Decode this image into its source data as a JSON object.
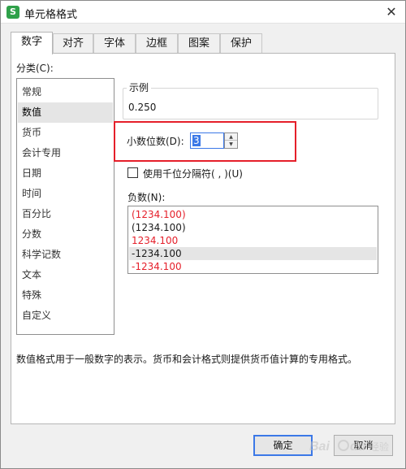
{
  "window": {
    "title": "单元格格式",
    "app_icon_letter": "S",
    "close_symbol": "✕"
  },
  "tabs": [
    {
      "label": "数字",
      "active": true
    },
    {
      "label": "对齐",
      "active": false
    },
    {
      "label": "字体",
      "active": false
    },
    {
      "label": "边框",
      "active": false
    },
    {
      "label": "图案",
      "active": false
    },
    {
      "label": "保护",
      "active": false
    }
  ],
  "category": {
    "label": "分类(C):",
    "items": [
      "常规",
      "数值",
      "货币",
      "会计专用",
      "日期",
      "时间",
      "百分比",
      "分数",
      "科学记数",
      "文本",
      "特殊",
      "自定义"
    ],
    "selected_index": 1
  },
  "sample": {
    "label": "示例",
    "value": "0.250"
  },
  "decimal": {
    "label": "小数位数(D):",
    "value": "3"
  },
  "thousands": {
    "label": "使用千位分隔符( , )(U)",
    "checked": false
  },
  "negative": {
    "label": "负数(N):",
    "items": [
      {
        "text": "(1234.100)",
        "color": "#e51f2a"
      },
      {
        "text": "(1234.100)",
        "color": "#1a1a1a"
      },
      {
        "text": "1234.100",
        "color": "#e51f2a"
      },
      {
        "text": "-1234.100",
        "color": "#1a1a1a"
      },
      {
        "text": "-1234.100",
        "color": "#e51f2a"
      }
    ],
    "selected_index": 3
  },
  "description": "数值格式用于一般数字的表示。货币和会计格式则提供货币值计算的专用格式。",
  "buttons": {
    "ok": "确定",
    "cancel": "取消"
  },
  "colors": {
    "accent": "#3b78e7",
    "highlight": "#e51f2a",
    "app_icon": "#2fa14a"
  },
  "watermark": {
    "text": "Bai du 经验"
  }
}
